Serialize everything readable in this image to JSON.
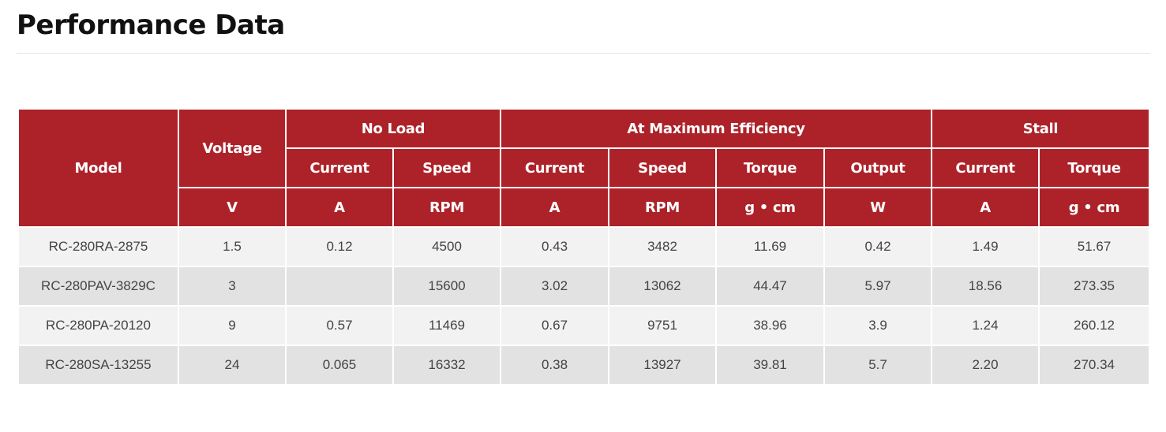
{
  "page": {
    "title": "Performance Data"
  },
  "table": {
    "headers": {
      "model": "Model",
      "voltage": "Voltage",
      "no_load": "No Load",
      "max_eff": "At Maximum Efficiency",
      "stall": "Stall",
      "sub": [
        "Current",
        "Speed",
        "Current",
        "Speed",
        "Torque",
        "Output",
        "Current",
        "Torque"
      ],
      "units": [
        "V",
        "A",
        "RPM",
        "A",
        "RPM",
        "g • cm",
        "W",
        "A",
        "g • cm"
      ]
    },
    "rows": [
      [
        "RC-280RA-2875",
        "1.5",
        "0.12",
        "4500",
        "0.43",
        "3482",
        "11.69",
        "0.42",
        "1.49",
        "51.67"
      ],
      [
        "RC-280PAV-3829C",
        "3",
        "",
        "15600",
        "3.02",
        "13062",
        "44.47",
        "5.97",
        "18.56",
        "273.35"
      ],
      [
        "RC-280PA-20120",
        "9",
        "0.57",
        "11469",
        "0.67",
        "9751",
        "38.96",
        "3.9",
        "1.24",
        "260.12"
      ],
      [
        "RC-280SA-13255",
        "24",
        "0.065",
        "16332",
        "0.38",
        "13927",
        "39.81",
        "5.7",
        "2.20",
        "270.34"
      ]
    ]
  },
  "colors": {
    "header_bg": "#ad2229",
    "row_light": "#f2f2f2",
    "row_dark": "#e2e2e2"
  }
}
